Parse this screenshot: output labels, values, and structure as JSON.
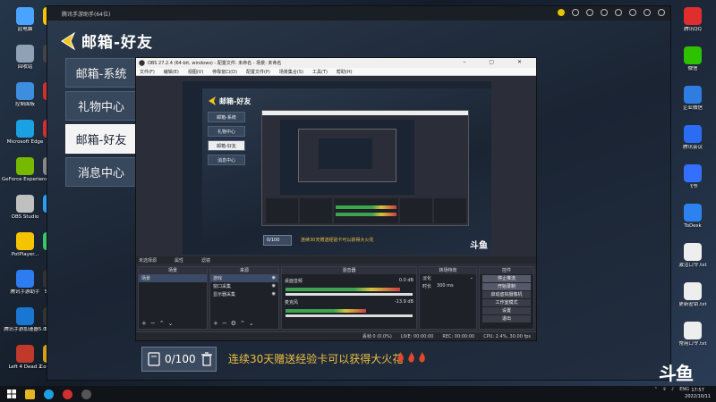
{
  "desktop": {
    "left_icons": [
      {
        "label": "此电脑",
        "color": "#4aa3ff"
      },
      {
        "label": "回收站",
        "color": "#8fa2b5"
      },
      {
        "label": "控制面板",
        "color": "#3e8ee0"
      },
      {
        "label": "Microsoft Edge",
        "color": "#1ba1e2"
      },
      {
        "label": "GeForce Experience",
        "color": "#76b900"
      },
      {
        "label": "OBS Studio",
        "color": "#c0c0c0"
      },
      {
        "label": "PotPlayer...",
        "color": "#f5c400"
      },
      {
        "label": "腾讯手游助手",
        "color": "#2d7df0"
      },
      {
        "label": "腾讯手游加速器5.0",
        "color": "#1976d2"
      },
      {
        "label": "Left 4 Dead 2",
        "color": "#c0392b"
      }
    ],
    "second_icons": [
      {
        "label": "YY",
        "color": "#f3c300"
      },
      {
        "label": "KO",
        "color": "#444"
      },
      {
        "label": "网易",
        "color": "#d03030"
      },
      {
        "label": "网易",
        "color": "#d03030"
      },
      {
        "label": "Ex",
        "color": "#888"
      },
      {
        "label": "",
        "color": "#2a9df4"
      },
      {
        "label": "We",
        "color": "#3ac569"
      },
      {
        "label": "SteGe",
        "color": "#333"
      },
      {
        "label": "SteGe",
        "color": "#333"
      },
      {
        "label": "Count Glo",
        "color": "#d4a017"
      }
    ],
    "right_icons": [
      {
        "label": "腾讯QQ",
        "color": "#e02e2e"
      },
      {
        "label": "微信",
        "color": "#2dc100"
      },
      {
        "label": "企业微信",
        "color": "#2f7de1"
      },
      {
        "label": "腾讯会议",
        "color": "#2a6df4"
      },
      {
        "label": "飞书",
        "color": "#3370ff"
      },
      {
        "label": "ToDesk",
        "color": "#2c83f0"
      },
      {
        "label": "激活口令.txt",
        "color": "#eeeeee"
      },
      {
        "label": "更新密钥.txt",
        "color": "#eeeeee"
      },
      {
        "label": "常用口令.txt",
        "color": "#eeeeee"
      }
    ]
  },
  "game_window": {
    "title": "腾讯手游助手(64位)",
    "header_title": "邮箱-好友",
    "menu": [
      {
        "label": "邮箱-系统",
        "active": false
      },
      {
        "label": "礼物中心",
        "active": false
      },
      {
        "label": "邮箱-好友",
        "active": true
      },
      {
        "label": "消息中心",
        "active": false
      }
    ]
  },
  "obs": {
    "title": "OBS 27.2.4 (64-bit, windows) - 配置文件: 未命名 - 场景: 未命名",
    "menus": [
      "文件(F)",
      "编辑(E)",
      "视图(V)",
      "停靠窗口(D)",
      "配置文件(P)",
      "场景集合(S)",
      "工具(T)",
      "帮助(H)"
    ],
    "nested_menu": [
      "邮箱-系统",
      "礼物中心",
      "邮箱-好友",
      "消息中心"
    ],
    "nested_header": "邮箱-好友",
    "no_source": "未选择源",
    "props_label": "属性",
    "filters_label": "滤镜",
    "docks": {
      "scenes": {
        "title": "场景",
        "items": [
          "场景"
        ]
      },
      "sources": {
        "title": "来源",
        "items": [
          "游戏",
          "窗口采集",
          "显示器采集"
        ]
      },
      "mixer": {
        "title": "混音器",
        "tracks": [
          {
            "name": "桌面音频",
            "db": "0.0 dB",
            "level": 0.85
          },
          {
            "name": "麦克风",
            "db": "-13.9 dB",
            "level": 0.6
          }
        ]
      },
      "transitions": {
        "title": "转场特效",
        "type": "淡化",
        "duration_label": "时长",
        "duration": "300 ms"
      },
      "controls": {
        "title": "控件",
        "buttons": [
          "停止推流",
          "开始录制",
          "启动虚拟摄像机",
          "工作室模式",
          "设置",
          "退出"
        ]
      }
    },
    "status": {
      "drops": "丢帧 0 (0.0%)",
      "live": "LIVE: 00:00:00",
      "rec": "REC: 00:00:00",
      "cpu": "CPU: 2.4%, 30.00 fps"
    }
  },
  "chat": {
    "count": "0/100",
    "message": "连续30天赠送经验卡可以获得大火花"
  },
  "logo": "斗鱼",
  "taskbar": {
    "lang": "ENG",
    "time": "17:57",
    "date": "2022/10/11"
  }
}
